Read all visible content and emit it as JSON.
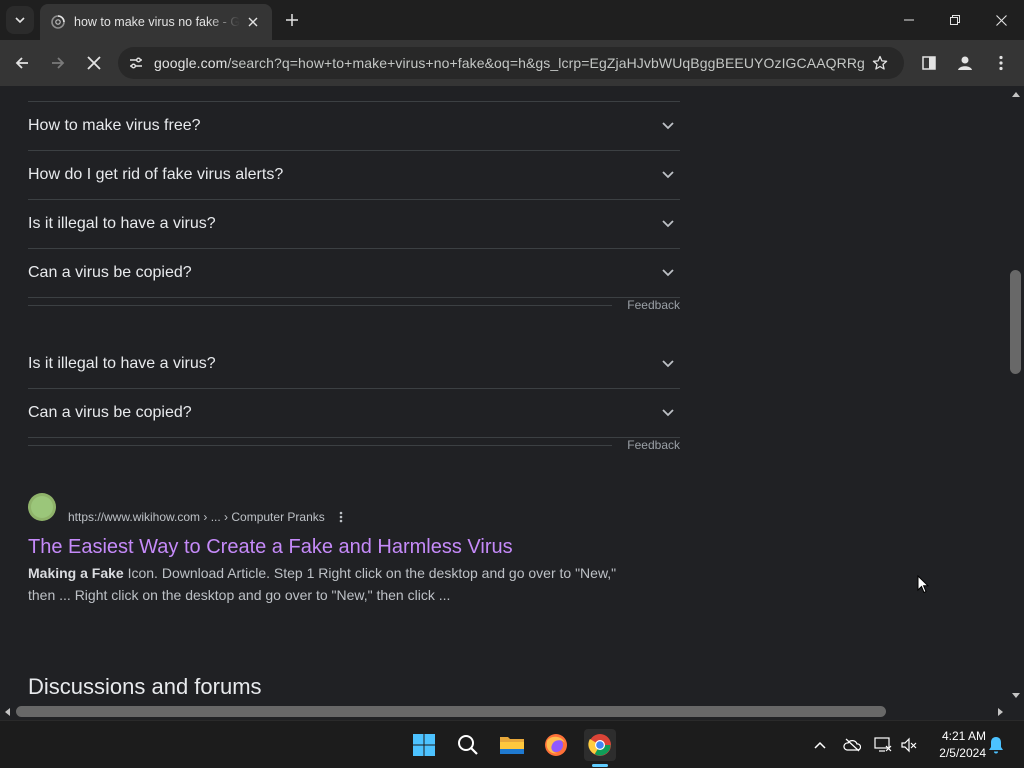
{
  "browser": {
    "tab": {
      "title": "how to make virus no fake - Google Search"
    },
    "omnibox": {
      "host": "google.com",
      "path": "/search?q=how+to+make+virus+no+fake&oq=h&gs_lcrp=EgZjaHJvbWUqBggBEEUYOzIGCAAQRRg..."
    }
  },
  "search": {
    "paa_group_1": [
      {
        "question": "How to make virus free?"
      },
      {
        "question": "How do I get rid of fake virus alerts?"
      },
      {
        "question": "Is it illegal to have a virus?"
      },
      {
        "question": "Can a virus be copied?"
      }
    ],
    "paa_group_2": [
      {
        "question": "Is it illegal to have a virus?"
      },
      {
        "question": "Can a virus be copied?"
      }
    ],
    "feedback_label": "Feedback",
    "result": {
      "url": "https://www.wikihow.com › ... › Computer Pranks",
      "title": "The Easiest Way to Create a Fake and Harmless Virus",
      "snippet_bold": "Making a Fake",
      "snippet_line1": " Icon. Download Article. Step 1 Right click on the desktop and go over to \"New,\"",
      "snippet_line2": "then ... Right click on the desktop and go over to \"New,\" then click ..."
    },
    "section_heading": "Discussions and forums"
  },
  "taskbar": {
    "clock_time": "4:21 AM",
    "clock_date": "2/5/2024"
  },
  "colors": {
    "visited_link": "#c58af9",
    "background": "#202124",
    "accent": "#60cdff"
  }
}
